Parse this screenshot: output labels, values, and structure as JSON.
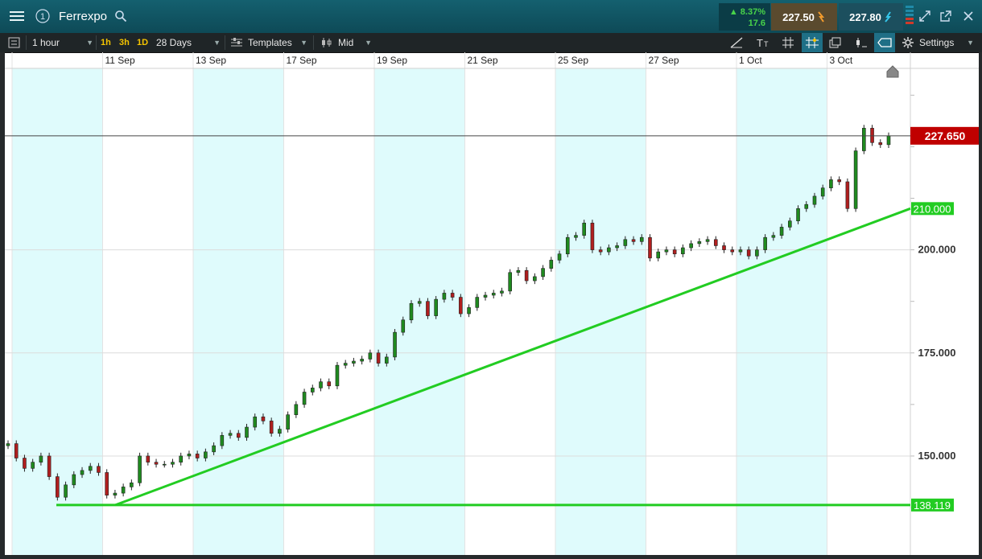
{
  "header": {
    "instrument": "Ferrexpo",
    "change_pct": "▲ 8.37%",
    "change_abs": "17.6",
    "sell_price": "227.50",
    "buy_price": "227.80",
    "colors": {
      "up": "#48d34a",
      "sell_bg": "#5a4a2e",
      "buy_bg": "#1c4f5e"
    }
  },
  "toolbar": {
    "interval": "1 hour",
    "quick_intervals": [
      "1h",
      "3h",
      "1D"
    ],
    "range": "28 Days",
    "templates": "Templates",
    "price_type": "Mid",
    "settings": "Settings"
  },
  "chart_data": {
    "type": "candlestick",
    "x_tick_labels": [
      "11 Sep",
      "13 Sep",
      "17 Sep",
      "19 Sep",
      "21 Sep",
      "25 Sep",
      "27 Sep",
      "1 Oct",
      "3 Oct"
    ],
    "y_tick_labels": [
      "200.000",
      "175.000",
      "150.000"
    ],
    "y_ticks": [
      200,
      175,
      150
    ],
    "ylim": [
      126,
      244
    ],
    "grid": true,
    "current_price": {
      "value": 227.65,
      "label": "227.650",
      "color": "#c00000"
    },
    "horizontal_lines": [
      {
        "value": 138.119,
        "label": "138.119",
        "color": "#22cc22"
      }
    ],
    "trendlines": [
      {
        "from": [
          0.122,
          138.119
        ],
        "to": [
          1.0,
          210.0
        ],
        "label": "210.000",
        "color": "#22cc22"
      }
    ],
    "close_series": [
      153.0,
      149.5,
      147.0,
      148.5,
      150.0,
      145.0,
      140.0,
      143.0,
      145.5,
      146.5,
      147.5,
      146.0,
      140.5,
      141.0,
      142.5,
      143.5,
      150.0,
      148.5,
      148.0,
      148.0,
      148.5,
      150.0,
      150.5,
      149.5,
      151.0,
      152.5,
      155.0,
      155.5,
      154.5,
      157.0,
      159.5,
      158.5,
      155.5,
      156.5,
      160.0,
      162.5,
      165.5,
      166.5,
      168.0,
      167.0,
      172.0,
      172.5,
      173.0,
      173.5,
      175.0,
      172.5,
      174.0,
      180.0,
      183.0,
      187.0,
      187.5,
      184.0,
      188.0,
      189.5,
      188.5,
      184.5,
      186.0,
      188.5,
      189.0,
      189.5,
      190.0,
      194.5,
      195.0,
      192.5,
      193.5,
      195.5,
      197.5,
      199.0,
      203.0,
      203.5,
      206.5,
      200.0,
      199.5,
      200.5,
      201.0,
      202.5,
      202.0,
      203.0,
      198.0,
      199.5,
      200.0,
      199.0,
      200.5,
      201.5,
      202.0,
      202.5,
      201.0,
      200.0,
      199.5,
      200.0,
      198.5,
      200.0,
      203.0,
      203.5,
      205.5,
      207.0,
      210.0,
      211.0,
      213.0,
      215.0,
      217.0,
      216.5,
      210.0,
      224.0,
      229.5,
      226.0,
      225.5,
      227.65
    ]
  }
}
